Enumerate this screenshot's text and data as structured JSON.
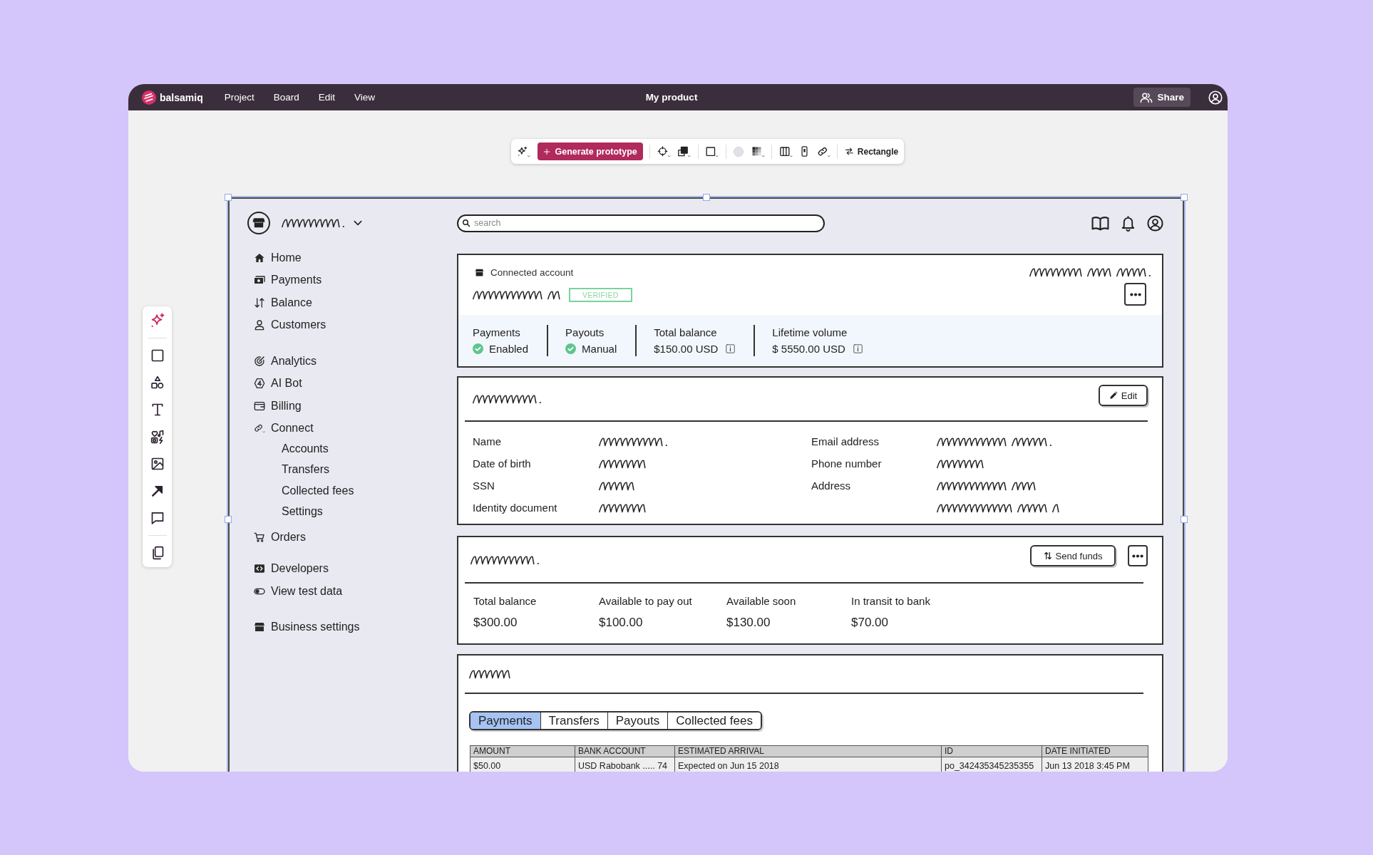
{
  "topbar": {
    "logo": "balsamiq",
    "menus": [
      "Project",
      "Board",
      "Edit",
      "View"
    ],
    "title": "My product",
    "share": "Share"
  },
  "toolbar": {
    "generate": "Generate prototype",
    "shape": "Rectangle"
  },
  "wireframe": {
    "sidebar": {
      "groups": [
        {
          "items": [
            {
              "label": "Home"
            },
            {
              "label": "Payments"
            },
            {
              "label": "Balance"
            },
            {
              "label": "Customers"
            }
          ]
        },
        {
          "items": [
            {
              "label": "Analytics"
            },
            {
              "label": "AI Bot"
            },
            {
              "label": "Billing"
            },
            {
              "label": "Connect",
              "children": [
                {
                  "label": "Accounts"
                },
                {
                  "label": "Transfers"
                },
                {
                  "label": "Collected fees"
                },
                {
                  "label": "Settings"
                }
              ]
            },
            {
              "label": "Orders"
            }
          ]
        },
        {
          "items": [
            {
              "label": "Developers"
            },
            {
              "label": "View test data"
            }
          ]
        },
        {
          "items": [
            {
              "label": "Business settings"
            }
          ]
        }
      ]
    },
    "search": {
      "placeholder": "search"
    },
    "account_card": {
      "label": "Connected account",
      "badge": "VERIFIED",
      "stats": [
        {
          "kind": "status",
          "label": "Payments",
          "value": "Enabled"
        },
        {
          "kind": "status",
          "label": "Payouts",
          "value": "Manual"
        },
        {
          "kind": "amount",
          "label": "Total balance",
          "value": "$150.00 USD"
        },
        {
          "kind": "amount",
          "label": "Lifetime volume",
          "value": "$ 5550.00 USD"
        }
      ]
    },
    "details_card": {
      "button": "Edit",
      "columns": [
        {
          "labels": [
            "Name",
            "Date of birth",
            "SSN",
            "Identity document"
          ]
        },
        {
          "labels": [
            "Email address",
            "Phone number",
            "Address"
          ]
        }
      ]
    },
    "balance_card": {
      "button": "Send funds",
      "items": [
        {
          "label": "Total balance",
          "value": "$300.00"
        },
        {
          "label": "Available to pay out",
          "value": "$100.00"
        },
        {
          "label": "Available soon",
          "value": "$130.00"
        },
        {
          "label": "In transit to bank",
          "value": "$70.00"
        }
      ]
    },
    "activity_card": {
      "tabs": [
        {
          "label": "Payments",
          "selected": true
        },
        {
          "label": "Transfers",
          "selected": false
        },
        {
          "label": "Payouts",
          "selected": false
        },
        {
          "label": "Collected fees",
          "selected": false
        }
      ],
      "table": {
        "columns": [
          "AMOUNT",
          "BANK ACCOUNT",
          "ESTIMATED ARRIVAL",
          "ID",
          "DATE INITIATED"
        ],
        "rows": [
          [
            "$50.00",
            "USD Rabobank ..... 74",
            "Expected on Jun 15 2018",
            "po_342435345235355",
            "Jun 13 2018 3:45 PM"
          ]
        ]
      }
    }
  }
}
